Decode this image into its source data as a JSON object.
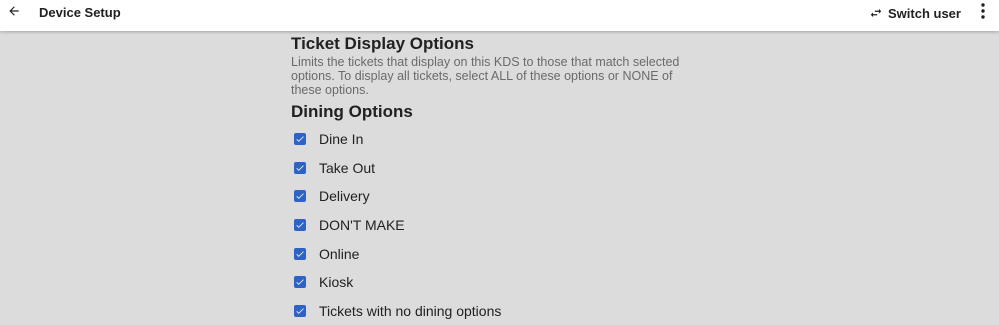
{
  "header": {
    "title": "Device Setup",
    "switch_user_label": "Switch user"
  },
  "ticket_display": {
    "title": "Ticket Display Options",
    "description": "Limits the tickets that display on this KDS to those that match selected options. To display all tickets, select ALL of these options or NONE of these options."
  },
  "dining": {
    "title": "Dining Options",
    "options": [
      {
        "label": "Dine In",
        "checked": true
      },
      {
        "label": "Take Out",
        "checked": true
      },
      {
        "label": "Delivery",
        "checked": true
      },
      {
        "label": "DON'T MAKE",
        "checked": true
      },
      {
        "label": "Online",
        "checked": true
      },
      {
        "label": "Kiosk",
        "checked": true
      },
      {
        "label": "Tickets with no dining options",
        "checked": true
      }
    ]
  },
  "colors": {
    "accent": "#2e63c5",
    "background": "#dcdcdc",
    "topbar": "#ffffff"
  },
  "icons": {
    "back": "arrow-left-icon",
    "switch_user": "swap-arrows-icon",
    "menu": "more-vertical-icon",
    "checkbox": "checkbox-checked-icon"
  }
}
